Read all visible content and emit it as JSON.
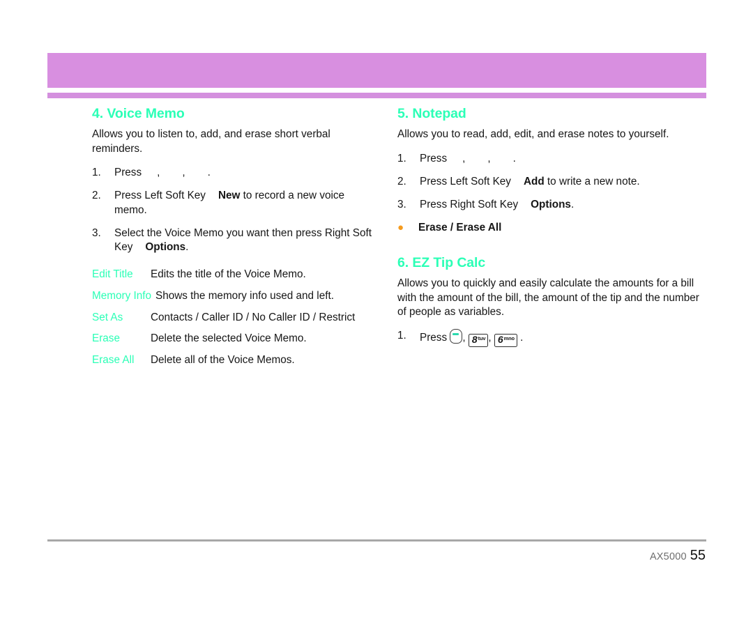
{
  "page": {
    "footer_model": "AX5000",
    "footer_page": "55",
    "banner_color": "#d88fe0",
    "heading_color": "#2bffb6",
    "bullet_color": "#f59b1e",
    "rule_color": "#a8a8a8"
  },
  "left_column": {
    "heading": "4. Voice Memo",
    "intro": "Allows you to listen to, add, and erase short verbal reminders.",
    "steps": [
      {
        "num": "1.",
        "lead": "Press",
        "comma1": ",",
        "comma2": ",",
        "period": "."
      },
      {
        "num": "2.",
        "lead": "Press Left Soft Key",
        "bold": "New",
        "tail": " to record a new voice memo."
      },
      {
        "num": "3.",
        "lead": "Select the Voice Memo you want then press Right Soft Key",
        "bold": "Options",
        "tail": "."
      }
    ],
    "options": [
      {
        "term": "Edit Title",
        "desc": "Edits the title of the Voice Memo."
      },
      {
        "term": "Memory Info",
        "desc": "Shows the memory info used and left."
      },
      {
        "term": "Set As",
        "desc": "Contacts / Caller ID / No Caller ID / Restrict"
      },
      {
        "term": "Erase",
        "desc": "Delete the selected Voice Memo."
      },
      {
        "term": "Erase All",
        "desc": "Delete all of the Voice Memos."
      }
    ]
  },
  "right_column": {
    "notepad": {
      "heading": "5. Notepad",
      "intro": "Allows you to read, add, edit, and erase notes to yourself.",
      "steps": [
        {
          "num": "1.",
          "lead": "Press",
          "comma1": ",",
          "comma2": ",",
          "period": "."
        },
        {
          "num": "2.",
          "lead": "Press Left Soft Key",
          "bold": "Add",
          "tail": " to write a new note."
        },
        {
          "num": "3.",
          "lead": "Press Right Soft Key",
          "bold": "Options",
          "tail": "."
        }
      ],
      "bullet": "Erase / Erase All"
    },
    "tipcalc": {
      "heading": "6. EZ Tip Calc",
      "intro": "Allows you to quickly and easily calculate the amounts for a bill with the amount of the bill, the amount of the tip and the number of people as variables.",
      "step": {
        "num": "1.",
        "lead": "Press",
        "comma1": ",",
        "comma2": ",",
        "period": ".",
        "keys": [
          {
            "type": "soft-key",
            "digit": "",
            "letters": ""
          },
          {
            "type": "number-key",
            "digit": "8",
            "letters": "tuv"
          },
          {
            "type": "number-key",
            "digit": "6",
            "letters": "mno"
          }
        ]
      }
    }
  }
}
